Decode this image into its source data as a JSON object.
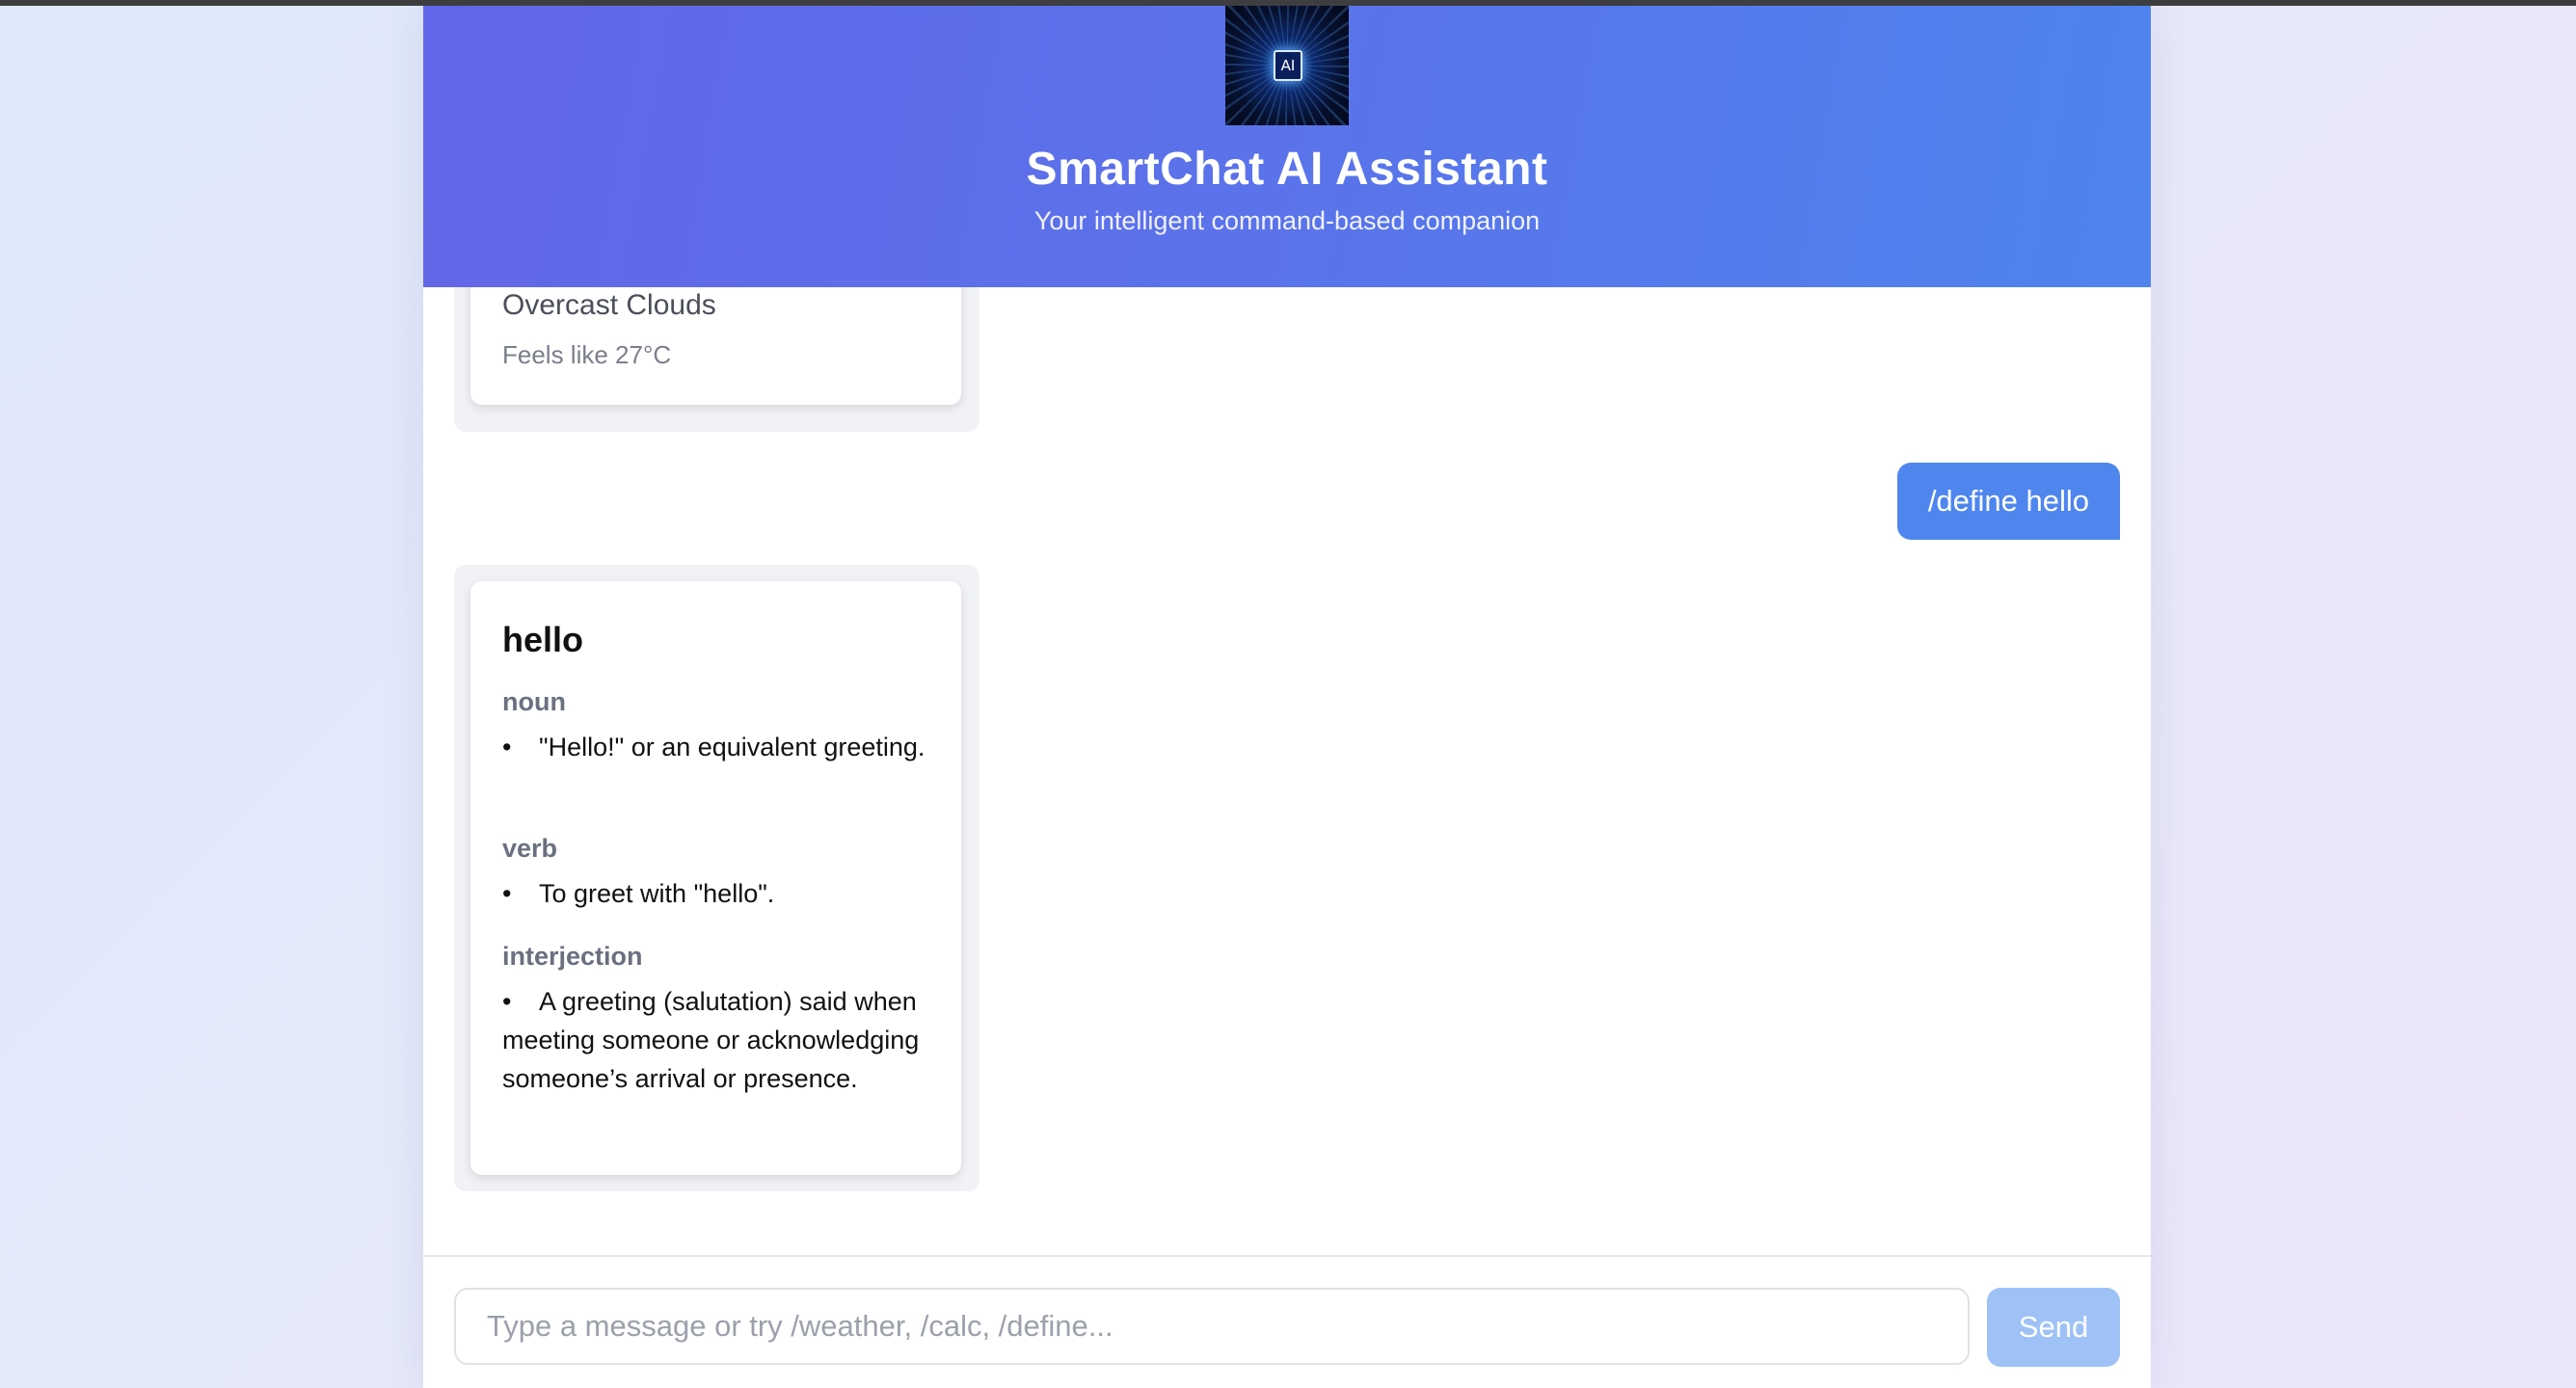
{
  "header": {
    "logo_text": "AI",
    "title": "SmartChat AI Assistant",
    "subtitle": "Your intelligent command-based companion"
  },
  "messages": {
    "weather": {
      "description": "Overcast Clouds",
      "feels_like": "Feels like 27°C"
    },
    "user": {
      "text": "/define hello"
    },
    "definition": {
      "word": "hello",
      "entries": [
        {
          "part_of_speech": "noun",
          "definitions": [
            "\"Hello!\" or an equivalent greeting."
          ]
        },
        {
          "part_of_speech": "verb",
          "definitions": [
            "To greet with \"hello\"."
          ]
        },
        {
          "part_of_speech": "interjection",
          "definitions": [
            "A greeting (salutation) said when meeting someone or acknowledging someone’s arrival or presence."
          ]
        }
      ]
    }
  },
  "composer": {
    "placeholder": "Type a message or try /weather, /calc, /define...",
    "send_label": "Send"
  }
}
